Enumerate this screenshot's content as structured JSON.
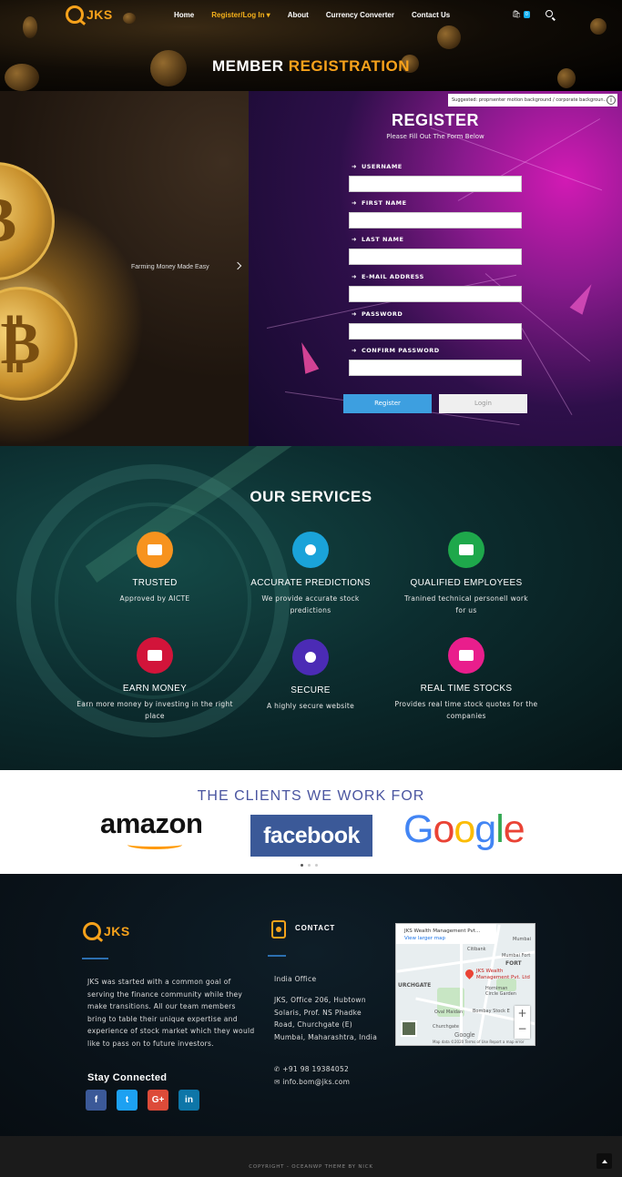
{
  "brand": {
    "logo_text": "JKS"
  },
  "nav": {
    "items": [
      "Home",
      "Register/Log In ▾",
      "About",
      "Currency Converter",
      "Contact Us"
    ],
    "cart_count": "0"
  },
  "page_title": {
    "part1": "MEMBER",
    "part2": "REGISTRATION"
  },
  "slider": {
    "caption": "Farming Money Made Easy"
  },
  "ad_note": "Suggested: proprsenter motion background / corporate backgroun...",
  "register": {
    "title": "REGISTER",
    "subtitle": "Please Fill Out The Form Below",
    "fields": [
      "USERNAME",
      "FIRST NAME",
      "LAST NAME",
      "E-MAIL ADDRESS",
      "PASSWORD",
      "CONFIRM PASSWORD"
    ],
    "register_button": "Register",
    "login_button": "Login"
  },
  "services": {
    "title": "OUR SERVICES",
    "items": [
      {
        "name": "TRUSTED",
        "desc": "Approved by AICTE",
        "color": "#f7931e",
        "icon": "handshake-icon"
      },
      {
        "name": "ACCURATE PREDICTIONS",
        "desc": "We provide accurate stock predictions",
        "color": "#1aa3d9",
        "icon": "bitcoin-icon"
      },
      {
        "name": "QUALIFIED EMPLOYEES",
        "desc": "Tranined technical personell work for us",
        "color": "#1ea84b",
        "icon": "id-card-icon"
      },
      {
        "name": "EARN MONEY",
        "desc": "Earn more money by investing in the right place",
        "color": "#d2143a",
        "icon": "money-icon"
      },
      {
        "name": "SECURE",
        "desc": "A highly secure website",
        "color": "#4b2bb5",
        "icon": "globe-icon"
      },
      {
        "name": "REAL TIME STOCKS",
        "desc": "Provides real time stock quotes for the companies",
        "color": "#e91e8c",
        "icon": "bank-icon"
      }
    ]
  },
  "clients": {
    "title": "THE CLIENTS WE WORK FOR",
    "amazon": "amazon",
    "facebook": "facebook",
    "google_letters": [
      {
        "ch": "G",
        "color": "#4285F4"
      },
      {
        "ch": "o",
        "color": "#EA4335"
      },
      {
        "ch": "o",
        "color": "#FBBC05"
      },
      {
        "ch": "g",
        "color": "#4285F4"
      },
      {
        "ch": "l",
        "color": "#34A853"
      },
      {
        "ch": "e",
        "color": "#EA4335"
      }
    ]
  },
  "footer": {
    "about": "JKS was started with a common goal of serving the finance community while they make transitions. All our team members bring to table their unique expertise and experience of stock market which they would like to pass on to future investors.",
    "stay_connected": "Stay Connected",
    "social": [
      {
        "name": "facebook",
        "glyph": "f",
        "color": "#3b5998"
      },
      {
        "name": "twitter",
        "glyph": "t",
        "color": "#1da1f2"
      },
      {
        "name": "google-plus",
        "glyph": "G+",
        "color": "#dd4b39"
      },
      {
        "name": "linkedin",
        "glyph": "in",
        "color": "#0e76a8"
      }
    ],
    "contact_heading": "CONTACT",
    "office_label": "India Office",
    "address": "JKS, Office 206, Hubtown Solaris, Prof. NS Phadke Road, Churchgate (E) Mumbai, Maharashtra, India",
    "phone": "+91 98 19384052",
    "email": "info.bom@jks.com",
    "map": {
      "place": "JKS Wealth Management Pvt...",
      "view_larger": "View larger map",
      "pin_label": "JKS Wealth Management Pvt. Ltd",
      "labels": [
        "FORT",
        "Mumbai Fort",
        "URCHGATE",
        "Oval Maidan",
        "Horniman Circle Garden",
        "Bombay Stock E",
        "Churchgate",
        "Citibank",
        "Mumbai"
      ],
      "credit": "Map data ©2020   Terms of Use   Report a map error"
    },
    "copyright": "COPYRIGHT - OCEANWP THEME BY NICK"
  }
}
